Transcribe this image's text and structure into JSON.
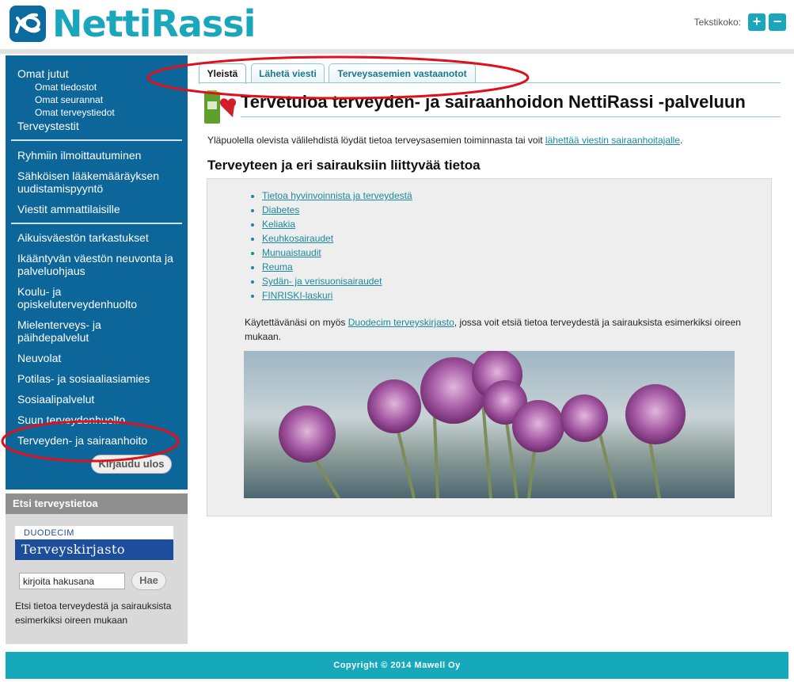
{
  "header": {
    "logo_text": "NettiRassi",
    "font_size_label": "Tekstikoko:",
    "increase_label": "+",
    "decrease_label": "−"
  },
  "sidebar": {
    "omat_jutut": "Omat jutut",
    "sub_items": [
      "Omat tiedostot",
      "Omat seurannat",
      "Omat terveystiedot"
    ],
    "terveystestit": "Terveystestit",
    "group2": [
      "Ryhmiin ilmoittautuminen",
      "Sähköisen lääkemääräyksen uudistamispyyntö",
      "Viestit ammattilaisille"
    ],
    "group3": [
      "Aikuisväestön tarkastukset",
      "Ikääntyvän väestön neuvonta ja palveluohjaus",
      "Koulu- ja opiskeluterveydenhuolto",
      "Mielenterveys- ja päihdepalvelut",
      "Neuvolat",
      "Potilas- ja sosiaaliasiamies",
      "Sosiaalipalvelut",
      "Suun terveydenhuolto",
      "Terveyden- ja sairaanhoito"
    ],
    "logout_label": "Kirjaudu ulos"
  },
  "search": {
    "title": "Etsi terveystietoa",
    "duodecim_top": "DUODECIM",
    "duodecim_bottom": "Terveyskirjasto",
    "input_value": "kirjoita hakusana",
    "button_label": "Hae",
    "description": "Etsi tietoa terveydestä ja sairauksista esimerkiksi oireen mukaan"
  },
  "tabs": [
    "Yleistä",
    "Lähetä viesti",
    "Terveysasemien vastaanotot"
  ],
  "main": {
    "title": "Tervetuloa terveyden- ja sairaanhoidon NettiRassi -palveluun",
    "intro_text": "Yläpuolella olevista välilehdistä löydät tietoa terveysasemien toiminnasta tai voit ",
    "intro_link": "lähettää viestin sairaanhoitajalle",
    "intro_end": ".",
    "section_title": "Terveyteen ja eri sairauksiin liittyvää tietoa",
    "links": [
      "Tietoa hyvinvoinnista ja terveydestä",
      "Diabetes",
      "Keliakia",
      "Keuhkosairaudet",
      "Munuaistaudit",
      "Reuma",
      "Sydän- ja verisuonisairaudet",
      "FINRISKI-laskuri"
    ],
    "info_text_start": "Käytettävänäsi on myös ",
    "info_link": "Duodecim terveyskirjasto",
    "info_text_end": ", jossa voit etsiä tietoa terveydestä ja sairauksista esimerkiksi oireen mukaan."
  },
  "footer": {
    "copyright": "Copyright © 2014 Mawell Oy"
  },
  "colors": {
    "brand": "#1aa6bb",
    "sidebar": "#0d6699",
    "annotation": "#e0101a"
  }
}
